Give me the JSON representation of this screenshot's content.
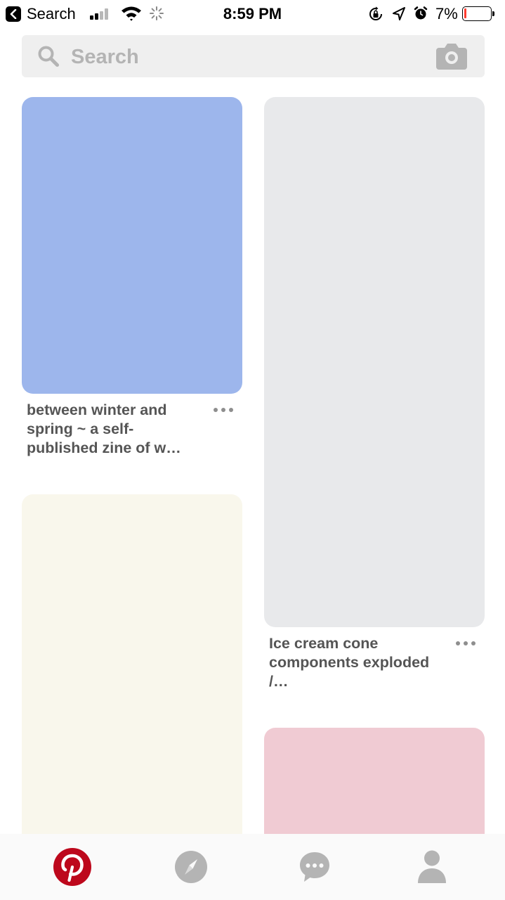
{
  "status_bar": {
    "back_app": "Search",
    "time": "8:59 PM",
    "battery_percent": "7%",
    "battery_level": 0.07,
    "battery_color": "#ff3b30",
    "signal_bars_filled": 2,
    "icons": [
      "back-arrow-icon",
      "signal-icon",
      "wifi-icon",
      "activity-spinner-icon",
      "orientation-lock-icon",
      "location-arrow-icon",
      "alarm-icon",
      "battery-icon"
    ]
  },
  "search": {
    "placeholder": "Search",
    "value": "",
    "icons": [
      "search-icon",
      "camera-icon"
    ]
  },
  "pins": [
    {
      "title": "between winter and spring ~ a self-published zine of w…",
      "image_color": "#9db6ec",
      "more_icon": "more-dots-icon"
    },
    {
      "title": "Ice cream cone components exploded /…",
      "image_color": "#e8e9eb",
      "more_icon": "more-dots-icon"
    },
    {
      "title": "",
      "image_color": "#f9f7ec"
    },
    {
      "title": "",
      "image_color": "#f0cbd3"
    }
  ],
  "tab_bar": {
    "tabs": [
      {
        "name": "home",
        "icon": "pinterest-logo-icon",
        "active": true,
        "color": "#bd081c"
      },
      {
        "name": "explore",
        "icon": "compass-icon",
        "active": false,
        "color": "#b4b4b4"
      },
      {
        "name": "messages",
        "icon": "chat-bubble-icon",
        "active": false,
        "color": "#b4b4b4"
      },
      {
        "name": "profile",
        "icon": "person-icon",
        "active": false,
        "color": "#b4b4b4"
      }
    ]
  }
}
